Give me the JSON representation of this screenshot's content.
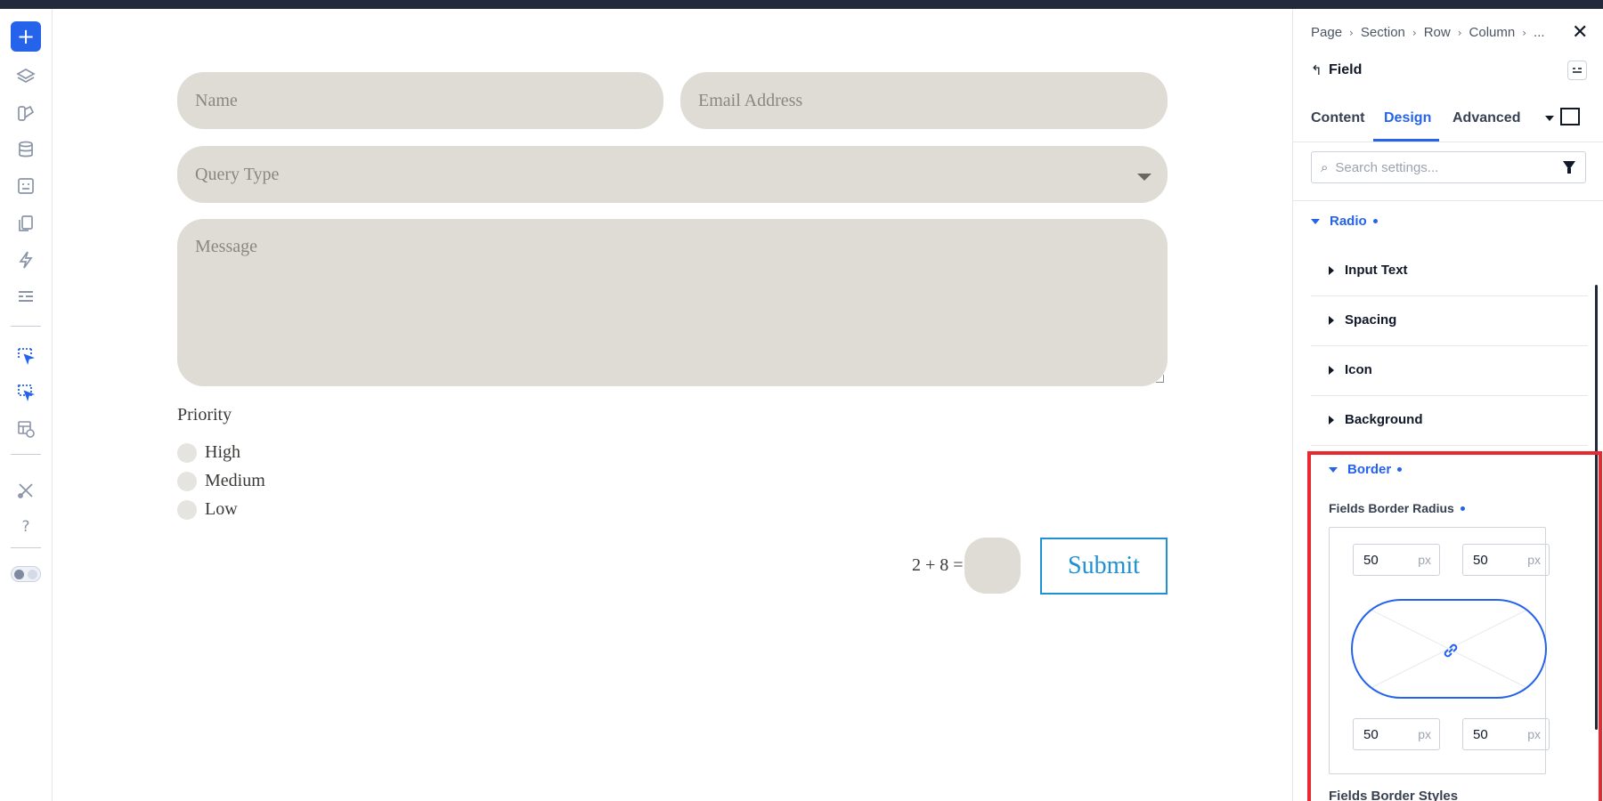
{
  "form": {
    "name_placeholder": "Name",
    "email_placeholder": "Email Address",
    "query_placeholder": "Query Type",
    "message_placeholder": "Message",
    "priority_label": "Priority",
    "priority_options": [
      "High",
      "Medium",
      "Low"
    ],
    "captcha_text": "2 + 8 =",
    "submit_label": "Submit"
  },
  "rail": {
    "icons": [
      "plus-icon",
      "layers-icon",
      "palette-icon",
      "database-icon",
      "form-icon",
      "pages-icon",
      "lightning-icon",
      "list-icon",
      "select-cursor-icon",
      "select-cursor-alt-icon",
      "layout-settings-icon",
      "tools-icon",
      "help-icon",
      "theme-toggle"
    ],
    "help_glyph": "?",
    "add_glyph": "+"
  },
  "panel": {
    "breadcrumbs": [
      "Page",
      "Section",
      "Row",
      "Column",
      "..."
    ],
    "crumb_sep": "›",
    "close_glyph": "✕",
    "back_glyph": "↰",
    "title": "Field",
    "tabs": [
      "Content",
      "Design",
      "Advanced"
    ],
    "active_tab": "Design",
    "search_placeholder": "Search settings...",
    "search_glyph": "⌕",
    "sections": {
      "radio": "Radio",
      "input_text": "Input Text",
      "spacing": "Spacing",
      "icon": "Icon",
      "background": "Background",
      "border": "Border"
    },
    "border": {
      "radius_label": "Fields Border Radius",
      "top_left": "50",
      "top_right": "50",
      "bottom_left": "50",
      "bottom_right": "50",
      "unit": "px",
      "link_glyph": "🔗",
      "next_label": "Fields Border Styles"
    },
    "accent": "#2563eb",
    "highlight": "#e8292f"
  }
}
